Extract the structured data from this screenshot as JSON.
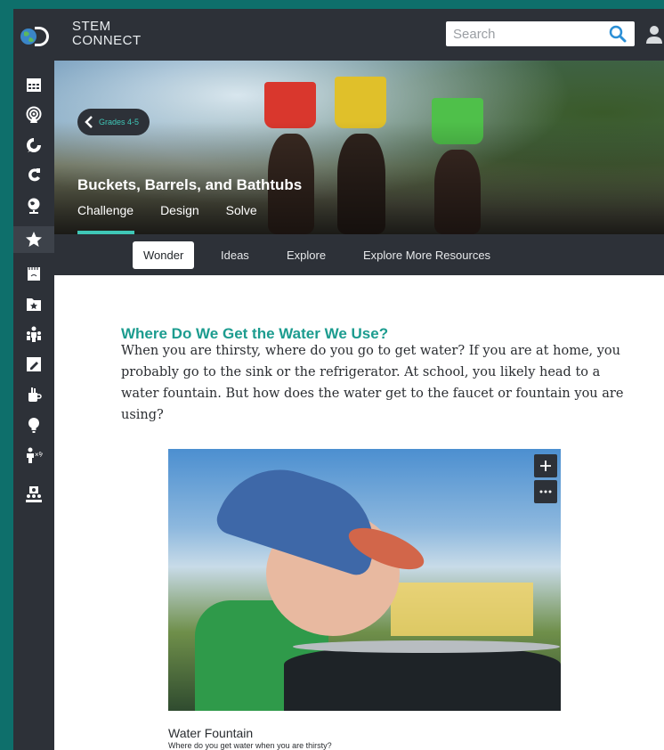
{
  "header": {
    "brand_line1": "STEM",
    "brand_line2": "CONNECT",
    "search_placeholder": "Search"
  },
  "sidebar": {
    "items": [
      {
        "icon": "calendar-icon"
      },
      {
        "icon": "broadcast-icon"
      },
      {
        "icon": "compass-icon"
      },
      {
        "icon": "magnet-icon"
      },
      {
        "icon": "globe-icon"
      },
      {
        "icon": "star-icon",
        "active": true
      },
      {
        "icon": "notebook-icon"
      },
      {
        "icon": "folder-star-icon"
      },
      {
        "icon": "people-icon"
      },
      {
        "icon": "pencil-icon"
      },
      {
        "icon": "cup-icon"
      },
      {
        "icon": "lightbulb-icon"
      },
      {
        "icon": "person-percent-icon"
      },
      {
        "icon": "group-icon"
      }
    ]
  },
  "hero": {
    "back_label": "Grades 4-5",
    "title": "Buckets, Barrels, and Bathtubs",
    "tabs": [
      "Challenge",
      "Design",
      "Solve"
    ],
    "active_tab": "Challenge"
  },
  "subnav": {
    "tabs": [
      "Wonder",
      "Ideas",
      "Explore",
      "Explore More Resources"
    ],
    "active_tab": "Wonder"
  },
  "content": {
    "section_title": "Where Do We Get the Water We Use?",
    "paragraph": "When you are thirsty, where do you go to get water? If you are at home, you probably go to the sink or the refrigerator. At school, you likely head to a water fountain. But how does the water get to the faucet or fountain you are using?",
    "figure": {
      "caption_title": "Water Fountain",
      "caption_text": "Where do you get water when you are thirsty?"
    }
  },
  "colors": {
    "accent": "#1c9c8f",
    "teal_highlight": "#3fc7b7",
    "dark_chrome": "#2d3138",
    "frame": "#0e6f6b"
  }
}
